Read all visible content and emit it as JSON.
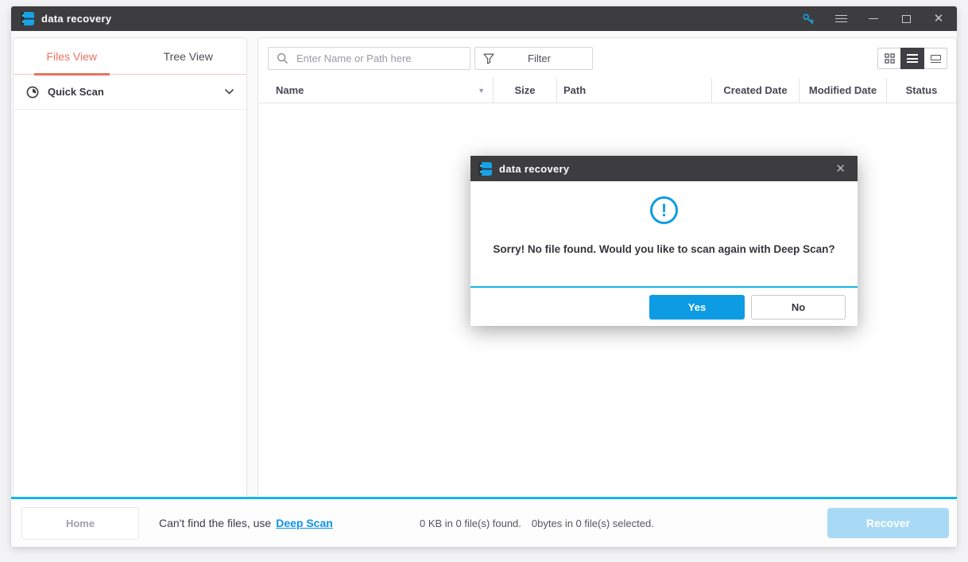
{
  "titlebar": {
    "title": "data recovery"
  },
  "sidebar": {
    "tabs": [
      {
        "label": "Files View",
        "active": true
      },
      {
        "label": "Tree View",
        "active": false
      }
    ],
    "quick_scan_label": "Quick Scan"
  },
  "toolbar": {
    "search_placeholder": "Enter Name or Path here",
    "filter_label": "Filter"
  },
  "table": {
    "columns": [
      "Name",
      "Size",
      "Path",
      "Created Date",
      "Modified Date",
      "Status"
    ],
    "rows": []
  },
  "dialog": {
    "title": "data recovery",
    "message": "Sorry! No file found. Would you like to scan again with Deep Scan?",
    "yes_label": "Yes",
    "no_label": "No"
  },
  "statusbar": {
    "home_label": "Home",
    "hint_prefix": "Can't find the files, use",
    "hint_link": "Deep Scan",
    "found_text": "0 KB in 0 file(s) found.",
    "selected_text": "0bytes in 0 file(s) selected.",
    "recover_label": "Recover"
  },
  "colors": {
    "titlebar_bg": "#3d3d3f",
    "accent_blue": "#0d9ce4",
    "cyan_line": "#16b5ea",
    "active_tab": "#e87360",
    "recover_disabled_bg": "#a9daf5",
    "link_blue": "#0c93ea"
  }
}
